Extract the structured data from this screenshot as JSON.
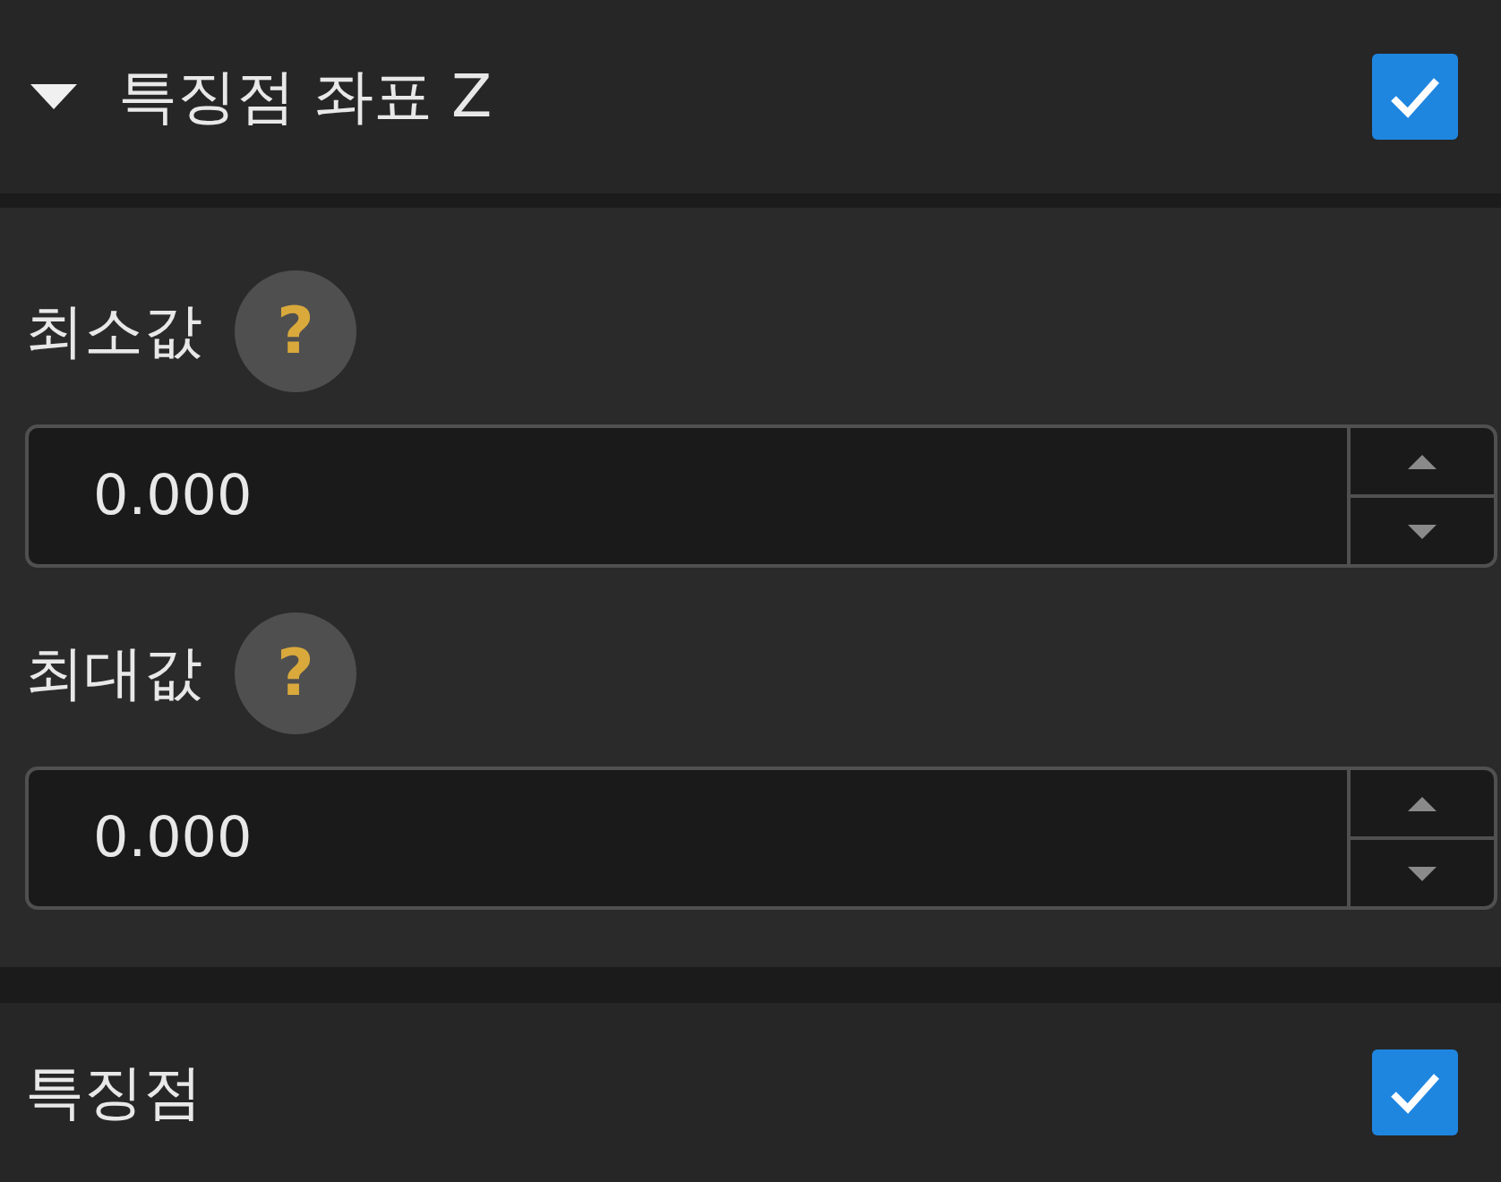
{
  "sections": [
    {
      "kind": "group",
      "title": "특징점 좌표 Z",
      "expanded": true,
      "checked": true,
      "fields": [
        {
          "label": "최소값",
          "help": "?",
          "value": "0.000"
        },
        {
          "label": "최대값",
          "help": "?",
          "value": "0.000"
        }
      ]
    },
    {
      "kind": "toggle",
      "title": "특징점",
      "checked": true
    }
  ]
}
